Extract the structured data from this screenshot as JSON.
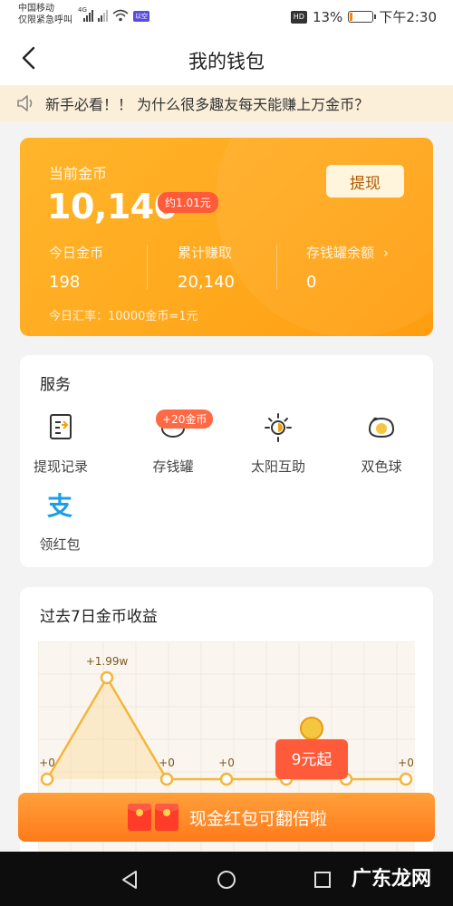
{
  "status_bar": {
    "carrier_line1": "中国移动",
    "carrier_line2": "仅限紧急呼叫",
    "network": "4G",
    "badge": "以空",
    "battery_percent": "13%",
    "battery_level": 0.13,
    "time": "下午2:30",
    "hd_label": "HD"
  },
  "header": {
    "title": "我的钱包",
    "back_icon": "chevron-left-icon"
  },
  "notice": {
    "icon": "speaker-icon",
    "text": "新手必看！！ 为什么很多趣友每天能赚上万金币？"
  },
  "wallet": {
    "current_label": "当前金币",
    "current_value": "10,140",
    "approx": "约1.01元",
    "withdraw_label": "提现",
    "stats": [
      {
        "label": "今日金币",
        "value": "198"
      },
      {
        "label": "累计赚取",
        "value": "20,140"
      },
      {
        "label": "存钱罐余额",
        "value": "0"
      }
    ],
    "rate_text": "今日汇率：10000金币=1元",
    "colors": {
      "card": "#ffaa1f",
      "approx_badge": "#ff5a3a"
    }
  },
  "services": {
    "title": "服务",
    "items": [
      {
        "label": "提现记录",
        "icon": "withdraw-record-icon"
      },
      {
        "label": "存钱罐",
        "icon": "piggy-bank-icon",
        "badge": "+20金币"
      },
      {
        "label": "太阳互助",
        "icon": "sun-icon"
      },
      {
        "label": "双色球",
        "icon": "lottery-ball-icon"
      },
      {
        "label": "领红包",
        "icon": "alipay-icon"
      }
    ]
  },
  "earnings": {
    "title": "过去7日金币收益",
    "peak_label": "+1.99w",
    "point_labels": [
      "+0",
      "+0",
      "+0",
      "+0",
      "+0"
    ],
    "promo_label": "9元起"
  },
  "chart_data": {
    "type": "line",
    "title": "过去7日金币收益",
    "x": [
      1,
      2,
      3,
      4,
      5,
      6,
      7
    ],
    "values": [
      0,
      19900,
      0,
      0,
      0,
      0,
      0
    ],
    "data_labels": [
      "+0",
      "+1.99w",
      "+0",
      "+0",
      "",
      "",
      "+0"
    ],
    "grid": true
  },
  "banner": {
    "text": "现金红包可翻倍啦",
    "icon": "red-envelope-icon"
  },
  "system_nav": {
    "back": "back-triangle-icon",
    "home": "home-circle-icon",
    "recent": "recent-square-icon"
  },
  "watermark": "广东龙网"
}
